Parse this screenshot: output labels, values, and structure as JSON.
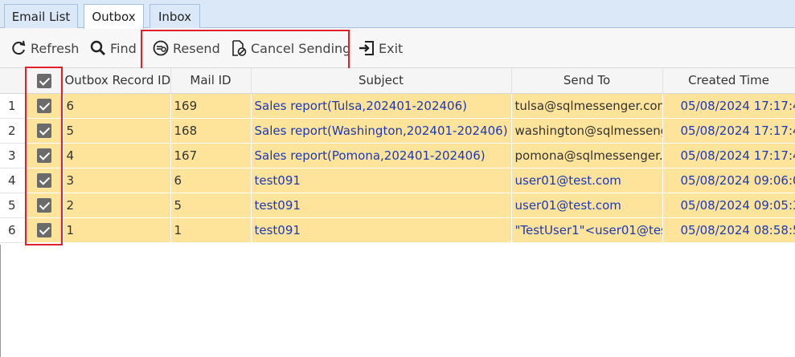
{
  "tabs": [
    {
      "label": "Email List",
      "active": false
    },
    {
      "label": "Outbox",
      "active": true
    },
    {
      "label": "Inbox",
      "active": false
    }
  ],
  "toolbar": {
    "refresh_label": "Refresh",
    "find_label": "Find",
    "resend_label": "Resend",
    "cancel_sending_label": "Cancel Sending",
    "exit_label": "Exit"
  },
  "grid": {
    "columns": [
      "",
      "",
      "Outbox Record ID",
      "Mail ID",
      "Subject",
      "Send To",
      "Created Time"
    ],
    "header_checked": true,
    "rows": [
      {
        "num": "1",
        "checked": true,
        "record_id": "6",
        "mail_id": "169",
        "subject": "Sales report(Tulsa,202401-202406)",
        "send_to": "tulsa@sqlmessenger.com",
        "created": "05/08/2024 17:17:4"
      },
      {
        "num": "2",
        "checked": true,
        "record_id": "5",
        "mail_id": "168",
        "subject": "Sales report(Washington,202401-202406)",
        "send_to": "washington@sqlmesseng",
        "created": "05/08/2024 17:17:4"
      },
      {
        "num": "3",
        "checked": true,
        "record_id": "4",
        "mail_id": "167",
        "subject": "Sales report(Pomona,202401-202406)",
        "send_to": "pomona@sqlmessenger.",
        "created": "05/08/2024 17:17:4"
      },
      {
        "num": "4",
        "checked": true,
        "record_id": "3",
        "mail_id": "6",
        "subject": "test091",
        "send_to": "user01@test.com",
        "created": "05/08/2024 09:06:0"
      },
      {
        "num": "5",
        "checked": true,
        "record_id": "2",
        "mail_id": "5",
        "subject": "test091",
        "send_to": "user01@test.com",
        "created": "05/08/2024 09:05:3"
      },
      {
        "num": "6",
        "checked": true,
        "record_id": "1",
        "mail_id": "1",
        "subject": "test091",
        "send_to": "\"TestUser1\"<user01@tes",
        "created": "05/08/2024 08:58:5"
      }
    ]
  },
  "colors": {
    "row_bg": "#fde49a",
    "link_text": "#1f39b5",
    "highlight": "#e0202a",
    "tab_strip": "#dbe8f7"
  },
  "icons": [
    "refresh-icon",
    "search-icon",
    "resend-icon",
    "cancel-sending-icon",
    "exit-icon",
    "checkbox-checked-icon"
  ]
}
